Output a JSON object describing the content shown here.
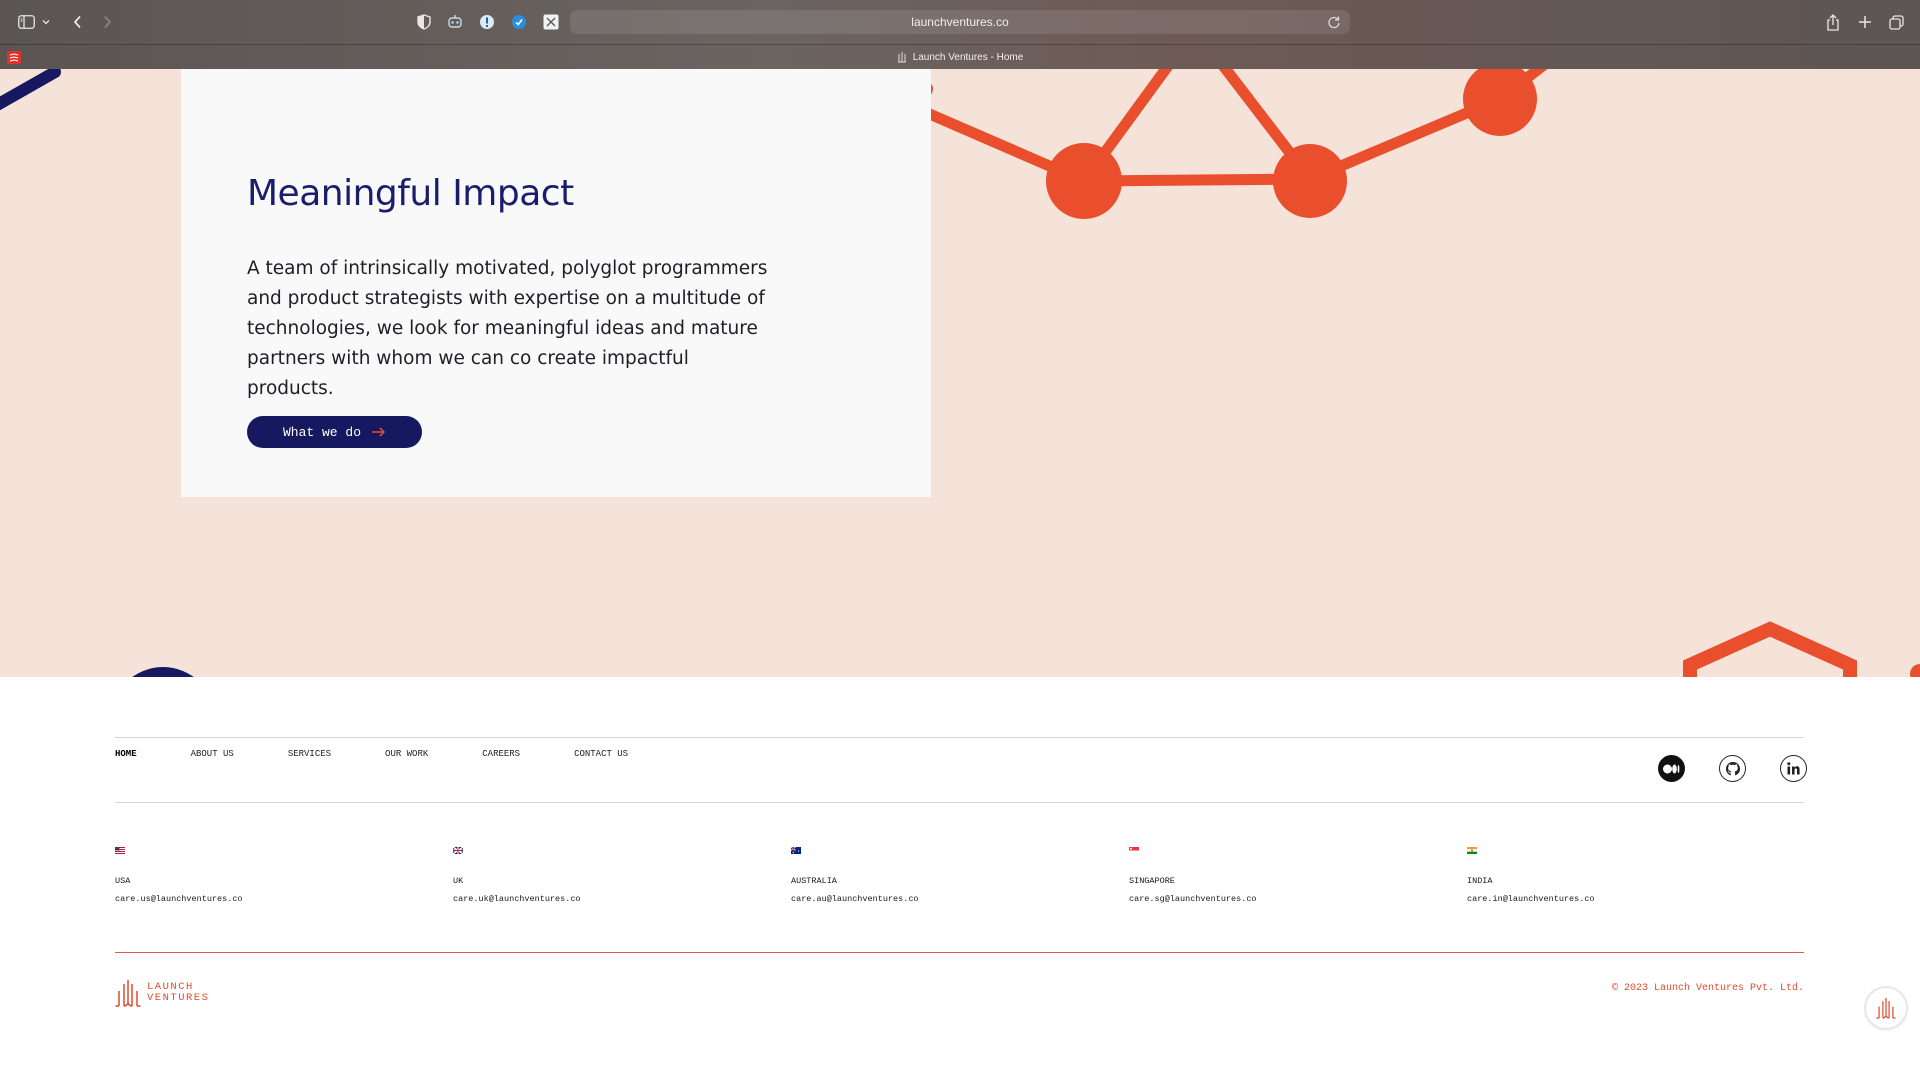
{
  "browser": {
    "url": "launchventures.co",
    "tab_title": "Launch Ventures - Home"
  },
  "hero": {
    "title": "Meaningful Impact",
    "description": "A team of intrinsically motivated, polyglot programmers and product strategists with expertise on a multitude of technologies, we look for meaningful ideas and mature partners with whom we can co create impactful products.",
    "cta_label": "What we do"
  },
  "footer": {
    "nav": [
      "HOME",
      "ABOUT US",
      "SERVICES",
      "OUR WORK",
      "CAREERS",
      "CONTACT US"
    ],
    "socials": [
      "medium-icon",
      "github-icon",
      "linkedin-icon"
    ],
    "offices": [
      {
        "country": "USA",
        "email": "care.us@launchventures.co",
        "flag": "us-flag-icon"
      },
      {
        "country": "UK",
        "email": "care.uk@launchventures.co",
        "flag": "uk-flag-icon"
      },
      {
        "country": "AUSTRALIA",
        "email": "care.au@launchventures.co",
        "flag": "au-flag-icon"
      },
      {
        "country": "SINGAPORE",
        "email": "care.sg@launchventures.co",
        "flag": "sg-flag-icon"
      },
      {
        "country": "INDIA",
        "email": "care.in@launchventures.co",
        "flag": "in-flag-icon"
      }
    ],
    "logo_line1": "LAUNCH",
    "logo_line2": "VENTURES",
    "copyright": "© 2023 Launch Ventures Pvt. Ltd."
  },
  "colors": {
    "hero_bg": "#f5e3da",
    "brand_orange": "#e94e2d",
    "brand_navy": "#171960"
  }
}
